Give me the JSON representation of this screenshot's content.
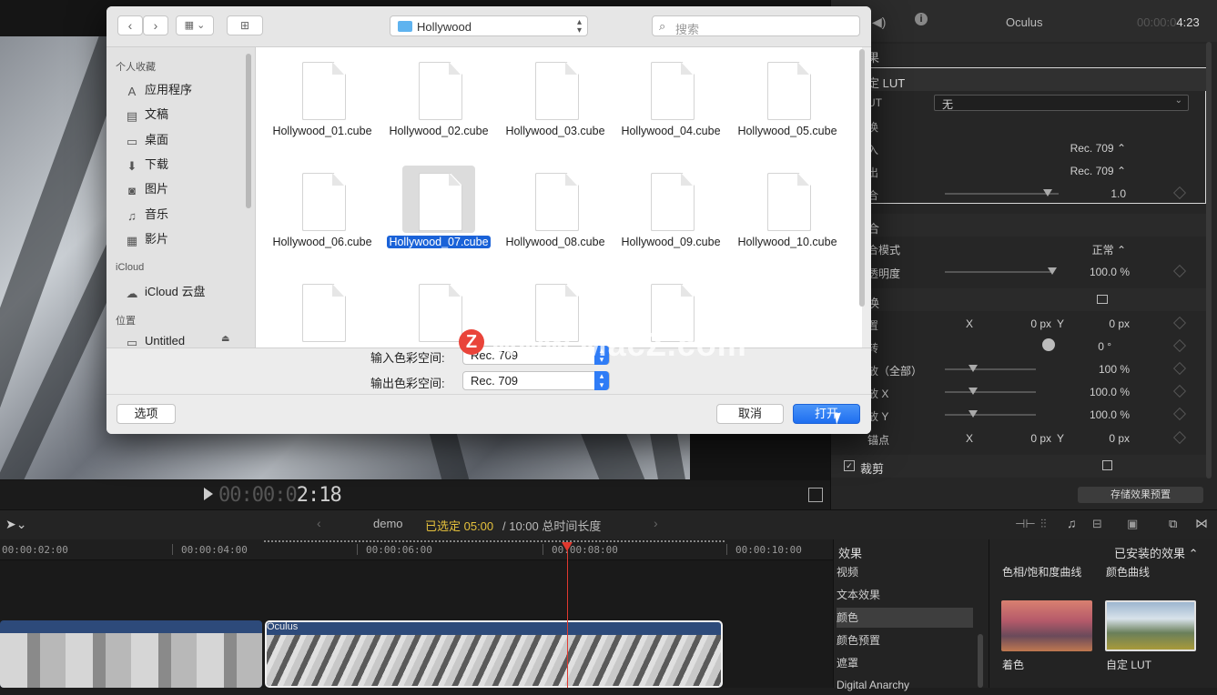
{
  "viewer": {
    "timecode_dim": "00:00:0",
    "timecode_bright": "2:18"
  },
  "inspector": {
    "clip_name": "Oculus",
    "duration_dim": "00:00:0",
    "duration_bright": "4:23",
    "section_effects": "果",
    "custom_lut_header": "定 LUT",
    "lut_label": "UT",
    "lut_value": "无",
    "convert_label": "换",
    "input_label": "入",
    "input_value": "Rec. 709 ⌃",
    "output_label": "出",
    "output_value": "Rec. 709 ⌃",
    "mix_label": "合",
    "mix_value": "1.0",
    "compositing_header": "合",
    "blend_mode_label": "合模式",
    "blend_mode_value": "正常 ⌃",
    "opacity_label": "透明度",
    "opacity_value": "100.0 %",
    "transform_header": "换",
    "position_label": "置",
    "pos_x_label": "X",
    "pos_x_value": "0 px",
    "pos_y_label": "Y",
    "pos_y_value": "0 px",
    "rotation_label": "转",
    "rotation_value": "0 °",
    "scale_all_label": "放（全部）",
    "scale_all_value": "100 %",
    "scale_x_label": "放 X",
    "scale_x_value": "100.0 %",
    "scale_y_label": "放 Y",
    "scale_y_value": "100.0 %",
    "anchor_label": "锚点",
    "anchor_x_label": "X",
    "anchor_x_value": "0 px",
    "anchor_y_label": "Y",
    "anchor_y_value": "0 px",
    "crop_label": "裁剪",
    "save_preset": "存储效果预置",
    "mix_level": 0.9,
    "opacity_level": 1.0
  },
  "timeline": {
    "project": "demo",
    "selected": "已选定 05:00",
    "total": "/ 10:00 总时间长度",
    "ticks": [
      "00:00:02:00",
      "00:00:04:00",
      "00:00:06:00",
      "00:00:08:00",
      "00:00:10:00"
    ],
    "clip_label": "Oculus"
  },
  "effects": {
    "title": "效果",
    "installed": "已安装的效果 ⌃",
    "categories": [
      "视频",
      "文本效果",
      "颜色",
      "颜色预置",
      "遮罩",
      "Digital Anarchy"
    ],
    "selected_category": "颜色",
    "top_names": [
      "色相/饱和度曲线",
      "颜色曲线"
    ],
    "items": [
      "着色",
      "自定 LUT"
    ]
  },
  "dialog": {
    "location": "Hollywood",
    "search_placeholder": "搜索",
    "sidebar": {
      "favorites_header": "个人收藏",
      "favorites": [
        {
          "icon": "applications-icon",
          "glyph": "A",
          "label": "应用程序"
        },
        {
          "icon": "documents-icon",
          "glyph": "▤",
          "label": "文稿"
        },
        {
          "icon": "desktop-icon",
          "glyph": "▭",
          "label": "桌面"
        },
        {
          "icon": "downloads-icon",
          "glyph": "⬇",
          "label": "下载"
        },
        {
          "icon": "pictures-icon",
          "glyph": "◙",
          "label": "图片"
        },
        {
          "icon": "music-icon",
          "glyph": "♫",
          "label": "音乐"
        },
        {
          "icon": "movies-icon",
          "glyph": "▦",
          "label": "影片"
        }
      ],
      "icloud_header": "iCloud",
      "icloud_item": "iCloud 云盘",
      "locations_header": "位置",
      "location_item": "Untitled"
    },
    "files": [
      "Hollywood_01.cube",
      "Hollywood_02.cube",
      "Hollywood_03.cube",
      "Hollywood_04.cube",
      "Hollywood_05.cube",
      "Hollywood_06.cube",
      "Hollywood_07.cube",
      "Hollywood_08.cube",
      "Hollywood_09.cube",
      "Hollywood_10.cube",
      "",
      "",
      "",
      ""
    ],
    "selected_file": "Hollywood_07.cube",
    "input_space_label": "输入色彩空间:",
    "input_space_value": "Rec. 709",
    "output_space_label": "输出色彩空间:",
    "output_space_value": "Rec. 709",
    "options_button": "选项",
    "cancel_button": "取消",
    "open_button": "打开"
  },
  "watermark": "www.MacZ.com",
  "watermark_logo": "Z"
}
